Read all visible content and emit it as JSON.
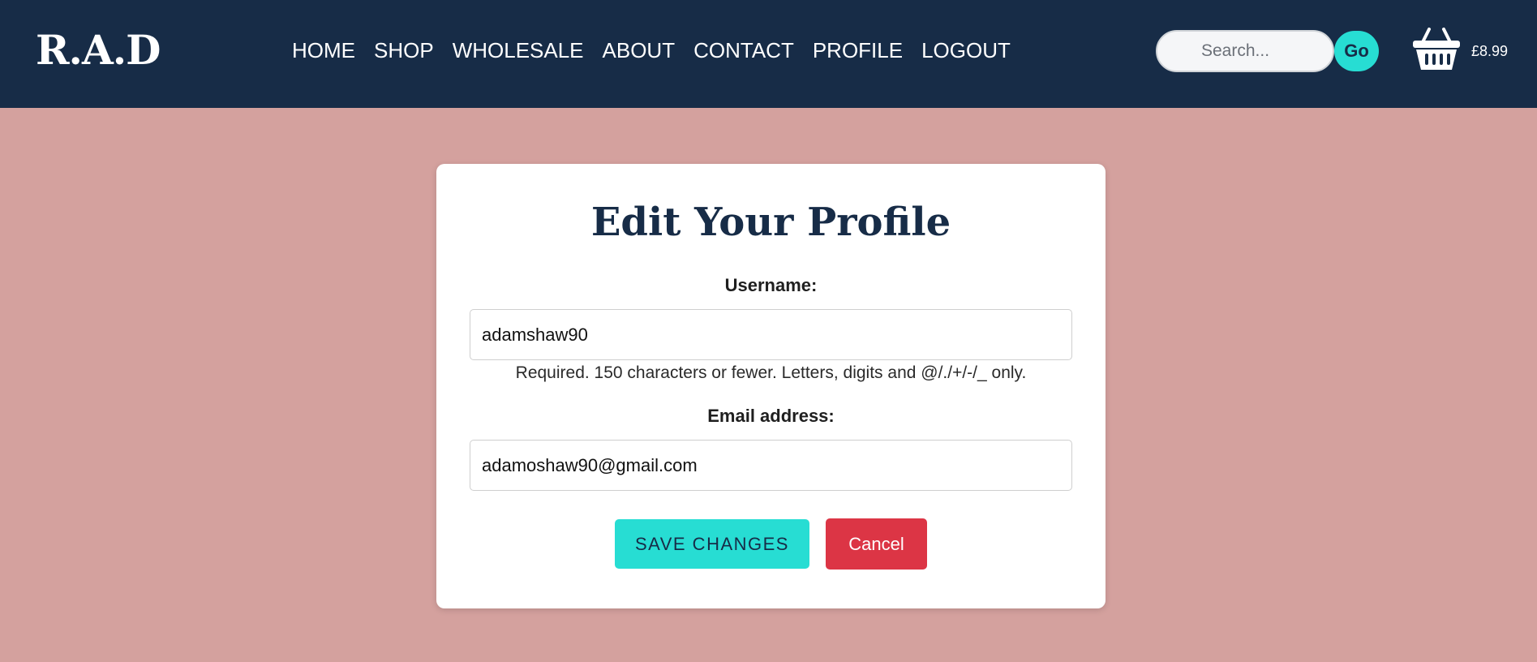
{
  "header": {
    "logo": "R.A.D",
    "nav": [
      "HOME",
      "SHOP",
      "WHOLESALE",
      "ABOUT",
      "CONTACT",
      "PROFILE",
      "LOGOUT"
    ],
    "search": {
      "placeholder": "Search...",
      "button_label": "Go"
    },
    "cart": {
      "icon": "basket-icon",
      "total": "£8.99"
    }
  },
  "form": {
    "title": "Edit Your Profile",
    "username": {
      "label": "Username:",
      "value": "adamshaw90",
      "help": "Required. 150 characters or fewer. Letters, digits and @/./+/-/_ only."
    },
    "email": {
      "label": "Email address:",
      "value": "adamoshaw90@gmail.com"
    },
    "save_label": "SAVE CHANGES",
    "cancel_label": "Cancel"
  },
  "colors": {
    "header_bg": "#172c47",
    "page_bg": "#d4a19e",
    "accent": "#27ddd3",
    "danger": "#dc3545"
  }
}
